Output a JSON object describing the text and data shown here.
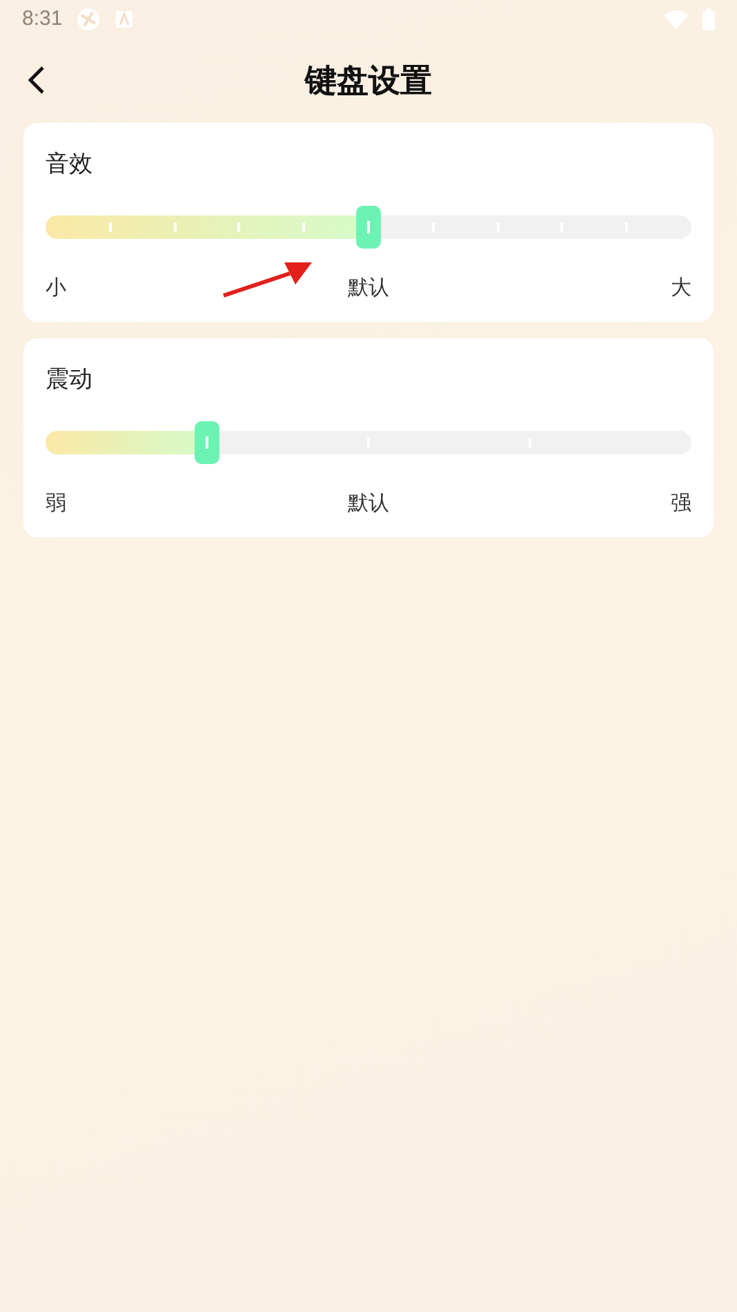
{
  "status_bar": {
    "time": "8:31"
  },
  "header": {
    "title": "键盘设置"
  },
  "settings": [
    {
      "title": "音效",
      "level": 0.5,
      "labels": [
        "小",
        "默认",
        "大"
      ]
    },
    {
      "title": "震动",
      "level": 0.25,
      "labels": [
        "弱",
        "默认",
        "强"
      ]
    }
  ]
}
